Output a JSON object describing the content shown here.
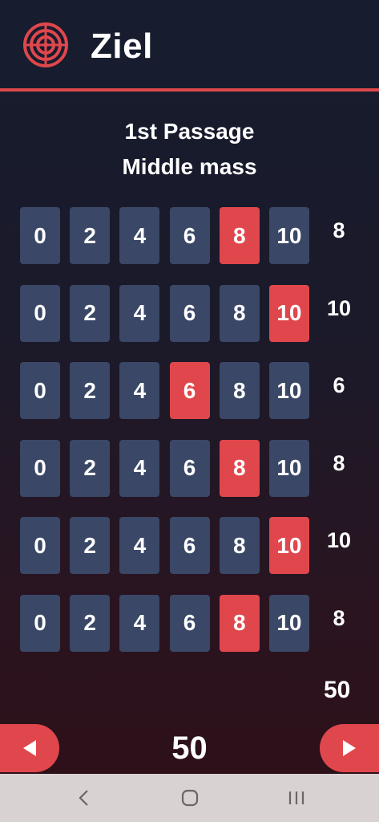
{
  "app": {
    "title": "Ziel",
    "icon": "target-icon",
    "accent_color": "#e0474c"
  },
  "passage": {
    "line1": "1st Passage",
    "line2": "Middle mass"
  },
  "rows": [
    {
      "options": [
        "0",
        "2",
        "4",
        "6",
        "8",
        "10"
      ],
      "selected": "8",
      "score": "8"
    },
    {
      "options": [
        "0",
        "2",
        "4",
        "6",
        "8",
        "10"
      ],
      "selected": "10",
      "score": "10"
    },
    {
      "options": [
        "0",
        "2",
        "4",
        "6",
        "8",
        "10"
      ],
      "selected": "6",
      "score": "6"
    },
    {
      "options": [
        "0",
        "2",
        "4",
        "6",
        "8",
        "10"
      ],
      "selected": "8",
      "score": "8"
    },
    {
      "options": [
        "0",
        "2",
        "4",
        "6",
        "8",
        "10"
      ],
      "selected": "10",
      "score": "10"
    },
    {
      "options": [
        "0",
        "2",
        "4",
        "6",
        "8",
        "10"
      ],
      "selected": "8",
      "score": "8"
    }
  ],
  "total_score": "50",
  "bottom": {
    "total": "50",
    "prev_icon": "arrow-left-icon",
    "next_icon": "arrow-right-icon"
  },
  "system_nav": {
    "back_icon": "back-icon",
    "home_icon": "home-icon",
    "recents_icon": "recents-icon"
  }
}
